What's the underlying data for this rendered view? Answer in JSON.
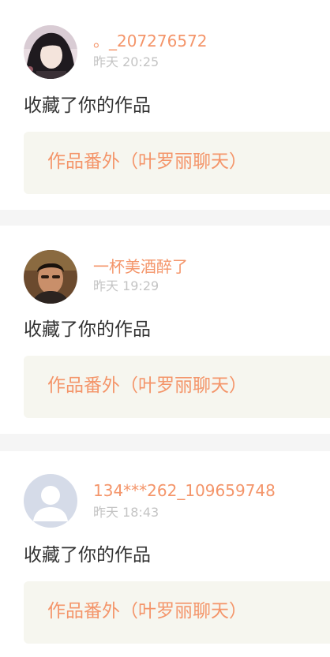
{
  "colors": {
    "accent": "#f4956a",
    "timestamp": "#c4c4c4",
    "body_text": "#333333",
    "work_box_bg": "#f6f6ef",
    "separator": "#f5f5f5"
  },
  "notifications": [
    {
      "avatar": "user-photo-girl",
      "username": "。_207276572",
      "time": "昨天 20:25",
      "action": "收藏了你的作品",
      "work_title": "作品番外（叶罗丽聊天）"
    },
    {
      "avatar": "user-photo-man",
      "username": "一杯美酒醉了",
      "time": "昨天 19:29",
      "action": "收藏了你的作品",
      "work_title": "作品番外（叶罗丽聊天）"
    },
    {
      "avatar": "default-avatar-icon",
      "username": "134***262_109659748",
      "time": "昨天 18:43",
      "action": "收藏了你的作品",
      "work_title": "作品番外（叶罗丽聊天）"
    }
  ]
}
